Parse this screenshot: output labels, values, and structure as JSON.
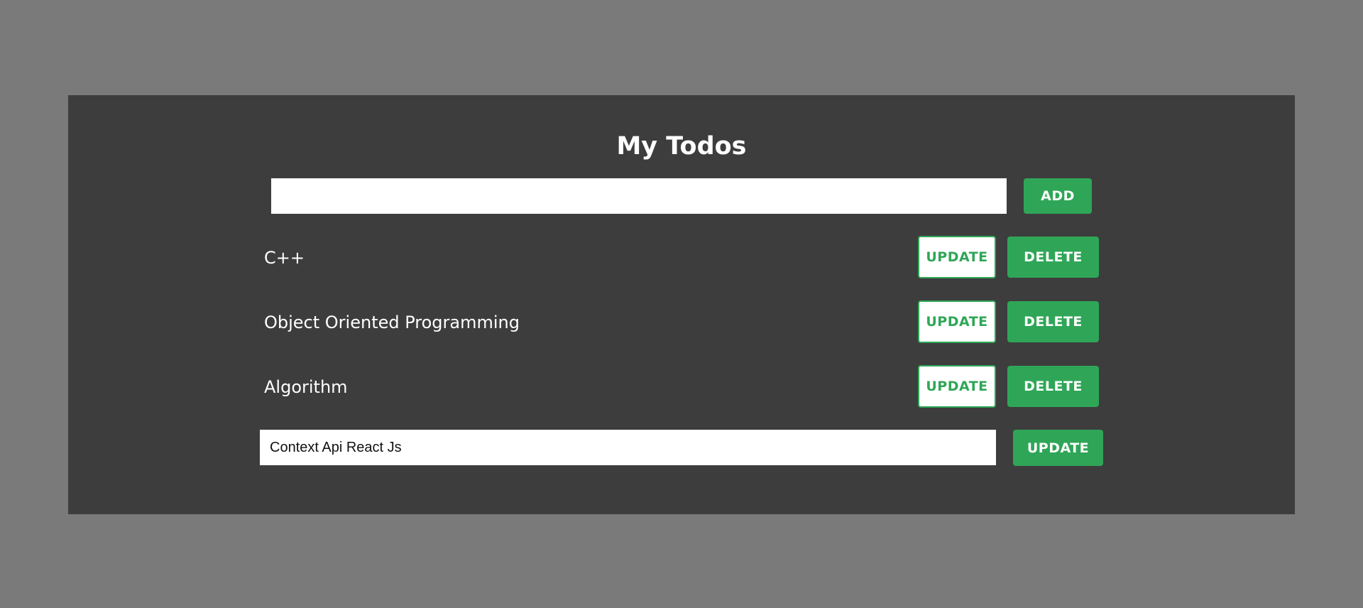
{
  "app": {
    "title": "My Todos"
  },
  "new_todo": {
    "value": "",
    "placeholder": "",
    "add_label": "ADD"
  },
  "todos": [
    {
      "text": "C++",
      "update_label": "UPDATE",
      "delete_label": "DELETE"
    },
    {
      "text": "Object Oriented Programming",
      "update_label": "UPDATE",
      "delete_label": "DELETE"
    },
    {
      "text": "Algorithm",
      "update_label": "UPDATE",
      "delete_label": "DELETE"
    }
  ],
  "edit": {
    "value": "Context Api React Js",
    "update_label": "UPDATE"
  },
  "colors": {
    "page_background": "#7a7a7a",
    "panel_background": "#3d3d3d",
    "accent_green": "#2fa657",
    "text_light": "#ffffff"
  }
}
